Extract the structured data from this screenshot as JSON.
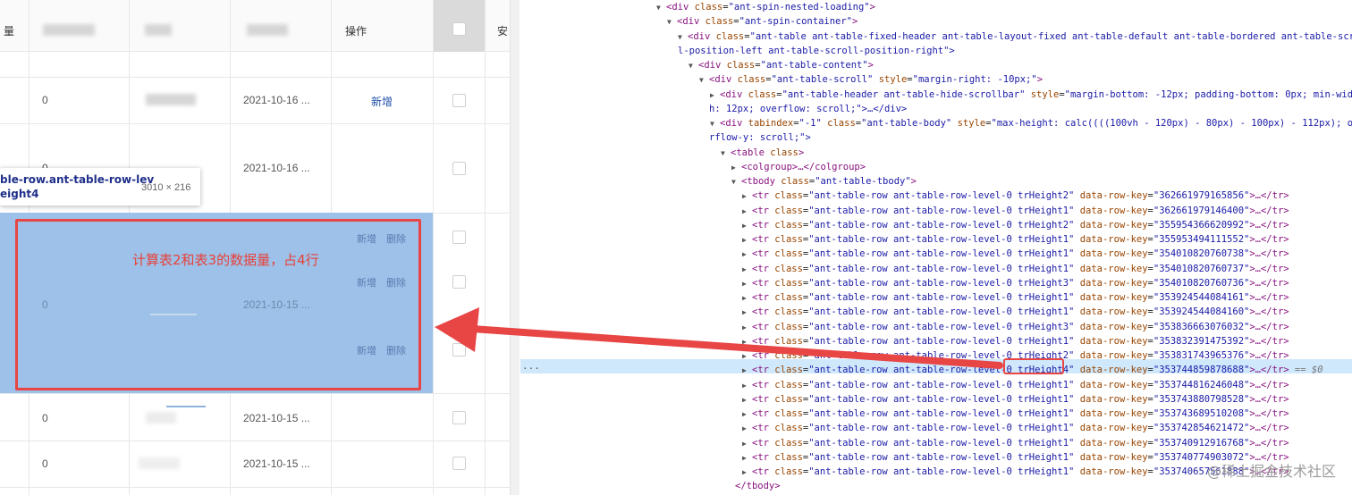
{
  "table": {
    "header_partial": "量",
    "header_actions": "操作",
    "header_partial_right": "安",
    "rows": [
      {
        "num": "0",
        "date": "2021-10-16 ...",
        "action": "新增"
      },
      {
        "num": "0",
        "date": "2021-10-16 ..."
      },
      {
        "num": "0",
        "date": "2021-10-15 ...",
        "actions": [
          "新增",
          "删除",
          "新增",
          "删除",
          "新增",
          "删除"
        ]
      },
      {
        "num": "0",
        "date": "2021-10-15 ..."
      },
      {
        "num": "0",
        "date": "2021-10-15 ..."
      }
    ]
  },
  "tooltip": {
    "line1": "ble-row.ant-table-row-lev",
    "line2": "eight4",
    "dims": "3010 × 216"
  },
  "annotation": "计算表2和表3的数据量，占4行",
  "devtools": {
    "lines": [
      {
        "tri": "▼",
        "open": "<div",
        "attrs": [
          [
            "class",
            "ant-spin-nested-loading"
          ]
        ],
        "close": ">"
      },
      {
        "tri": "▼",
        "open": "<div",
        "attrs": [
          [
            "class",
            "ant-spin-container"
          ]
        ],
        "close": ">"
      },
      {
        "tri": "▼",
        "open": "<div",
        "attrs": [
          [
            "class",
            "ant-table ant-table-fixed-header ant-table-layout-fixed ant-table-default ant-table-bordered ant-table-scrol"
          ]
        ],
        "close": ""
      },
      {
        "cont": "l-position-left ant-table-scroll-position-right\">"
      },
      {
        "tri": "▼",
        "open": "<div",
        "attrs": [
          [
            "class",
            "ant-table-content"
          ]
        ],
        "close": ">"
      },
      {
        "tri": "▼",
        "open": "<div",
        "attrs": [
          [
            "class",
            "ant-table-scroll"
          ],
          [
            "style",
            "margin-right: -10px;"
          ]
        ],
        "close": ">"
      },
      {
        "tri": "▶",
        "open": "<div",
        "attrs": [
          [
            "class",
            "ant-table-header ant-table-hide-scrollbar"
          ],
          [
            "style",
            "margin-bottom: -12px; padding-bottom: 0px; min-widt"
          ]
        ],
        "close": ""
      },
      {
        "cont": "h: 12px; overflow: scroll;\">…</div>"
      },
      {
        "tri": "▼",
        "open": "<div",
        "attrs": [
          [
            "tabindex",
            "-1"
          ],
          [
            "class",
            "ant-table-body"
          ],
          [
            "style",
            "max-height: calc((((100vh - 120px) - 80px) - 100px) - 112px); ove"
          ]
        ],
        "close": ""
      },
      {
        "cont": "rflow-y: scroll;\">"
      },
      {
        "tri": "▼",
        "open": "<table",
        "attrs": [],
        "bare": "class",
        "close": ">"
      },
      {
        "tri": "▶",
        "open": "<colgroup>…</colgroup>",
        "attrs": [],
        "close": ""
      },
      {
        "tri": "▼",
        "open": "<tbody",
        "attrs": [
          [
            "class",
            "ant-table-tbody"
          ]
        ],
        "close": ">"
      },
      {
        "tri": "▶",
        "open": "<tr",
        "attrs": [
          [
            "class",
            "ant-table-row ant-table-row-level-0  trHeight2"
          ],
          [
            "data-row-key",
            "362661979165856"
          ]
        ],
        "close": ">…</tr>"
      },
      {
        "tri": "▶",
        "open": "<tr",
        "attrs": [
          [
            "class",
            "ant-table-row ant-table-row-level-0  trHeight1"
          ],
          [
            "data-row-key",
            "362661979146400"
          ]
        ],
        "close": ">…</tr>"
      },
      {
        "tri": "▶",
        "open": "<tr",
        "attrs": [
          [
            "class",
            "ant-table-row ant-table-row-level-0  trHeight2"
          ],
          [
            "data-row-key",
            "355954366620992"
          ]
        ],
        "close": ">…</tr>"
      },
      {
        "tri": "▶",
        "open": "<tr",
        "attrs": [
          [
            "class",
            "ant-table-row ant-table-row-level-0  trHeight1"
          ],
          [
            "data-row-key",
            "355953494111552"
          ]
        ],
        "close": ">…</tr>"
      },
      {
        "tri": "▶",
        "open": "<tr",
        "attrs": [
          [
            "class",
            "ant-table-row ant-table-row-level-0  trHeight1"
          ],
          [
            "data-row-key",
            "354010820760738"
          ]
        ],
        "close": ">…</tr>"
      },
      {
        "tri": "▶",
        "open": "<tr",
        "attrs": [
          [
            "class",
            "ant-table-row ant-table-row-level-0  trHeight1"
          ],
          [
            "data-row-key",
            "354010820760737"
          ]
        ],
        "close": ">…</tr>"
      },
      {
        "tri": "▶",
        "open": "<tr",
        "attrs": [
          [
            "class",
            "ant-table-row ant-table-row-level-0  trHeight3"
          ],
          [
            "data-row-key",
            "354010820760736"
          ]
        ],
        "close": ">…</tr>"
      },
      {
        "tri": "▶",
        "open": "<tr",
        "attrs": [
          [
            "class",
            "ant-table-row ant-table-row-level-0  trHeight1"
          ],
          [
            "data-row-key",
            "353924544084161"
          ]
        ],
        "close": ">…</tr>"
      },
      {
        "tri": "▶",
        "open": "<tr",
        "attrs": [
          [
            "class",
            "ant-table-row ant-table-row-level-0  trHeight1"
          ],
          [
            "data-row-key",
            "353924544084160"
          ]
        ],
        "close": ">…</tr>"
      },
      {
        "tri": "▶",
        "open": "<tr",
        "attrs": [
          [
            "class",
            "ant-table-row ant-table-row-level-0  trHeight3"
          ],
          [
            "data-row-key",
            "353836663076032"
          ]
        ],
        "close": ">…</tr>"
      },
      {
        "tri": "▶",
        "open": "<tr",
        "attrs": [
          [
            "class",
            "ant-table-row ant-table-row-level-0  trHeight1"
          ],
          [
            "data-row-key",
            "353832391475392"
          ]
        ],
        "close": ">…</tr>"
      },
      {
        "tri": "▶",
        "open": "<tr",
        "attrs": [
          [
            "class",
            "ant-table-row ant-table-row-level-0  trHeight2"
          ],
          [
            "data-row-key",
            "353831743965376"
          ]
        ],
        "close": ">…</tr>"
      },
      {
        "tri": "▶",
        "open": "<tr",
        "attrs": [
          [
            "class",
            "ant-table-row ant-table-row-level-0  trHeight4"
          ],
          [
            "data-row-key",
            "353744859878688"
          ]
        ],
        "close": ">…</tr> == $0",
        "selected": true
      },
      {
        "tri": "▶",
        "open": "<tr",
        "attrs": [
          [
            "class",
            "ant-table-row ant-table-row-level-0  trHeight1"
          ],
          [
            "data-row-key",
            "353744816246048"
          ]
        ],
        "close": ">…</tr>"
      },
      {
        "tri": "▶",
        "open": "<tr",
        "attrs": [
          [
            "class",
            "ant-table-row ant-table-row-level-0  trHeight1"
          ],
          [
            "data-row-key",
            "353743880798528"
          ]
        ],
        "close": ">…</tr>"
      },
      {
        "tri": "▶",
        "open": "<tr",
        "attrs": [
          [
            "class",
            "ant-table-row ant-table-row-level-0  trHeight1"
          ],
          [
            "data-row-key",
            "353743689510208"
          ]
        ],
        "close": ">…</tr>"
      },
      {
        "tri": "▶",
        "open": "<tr",
        "attrs": [
          [
            "class",
            "ant-table-row ant-table-row-level-0  trHeight1"
          ],
          [
            "data-row-key",
            "353742854621472"
          ]
        ],
        "close": ">…</tr>"
      },
      {
        "tri": "▶",
        "open": "<tr",
        "attrs": [
          [
            "class",
            "ant-table-row ant-table-row-level-0  trHeight1"
          ],
          [
            "data-row-key",
            "353740912916768"
          ]
        ],
        "close": ">…</tr>"
      },
      {
        "tri": "▶",
        "open": "<tr",
        "attrs": [
          [
            "class",
            "ant-table-row ant-table-row-level-0  trHeight1"
          ],
          [
            "data-row-key",
            "353740774903072"
          ]
        ],
        "close": ">…</tr>"
      },
      {
        "tri": "▶",
        "open": "<tr",
        "attrs": [
          [
            "class",
            "ant-table-row ant-table-row-level-0  trHeight1"
          ],
          [
            "data-row-key",
            "353740657561888"
          ]
        ],
        "close": ">…</tr>"
      },
      {
        "cont": "</tbody>",
        "tag": true
      }
    ],
    "selected_dots": "...",
    "watermark": "@稀土掘金技术社区"
  },
  "colors": {
    "highlight": "#9dc1e8",
    "annotation_red": "#e84545",
    "tag": "#881280",
    "attr_name": "#994500",
    "attr_value": "#1a1aa6",
    "selected_row": "#cfe8fc"
  }
}
